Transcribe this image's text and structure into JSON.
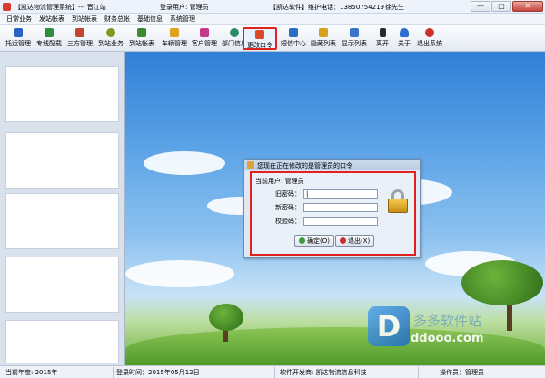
{
  "window": {
    "title": "【凯达物流管理系统】--- 晋江站",
    "login_user": "登录用户: 管理员",
    "vendor": "【凯达软件】维护电话：13850754219",
    "contact": "徐先生",
    "minimize": "—",
    "maximize": "□",
    "close": "✕"
  },
  "menu": [
    "日常业务",
    "发站帐表",
    "到站帐表",
    "财务总帐",
    "基础信息",
    "系统管理"
  ],
  "toolbar": [
    {
      "label": "托运管理",
      "icon": "consign-icon",
      "color": "#2a62c7"
    },
    {
      "label": "专线配载",
      "icon": "route-icon",
      "color": "#2f8f3e"
    },
    {
      "label": "三方管理",
      "icon": "partner-icon",
      "color": "#c6452c"
    },
    {
      "label": "到站业务",
      "icon": "arrival-icon",
      "color": "#7a9a20"
    },
    {
      "label": "到站帐表",
      "icon": "report-icon",
      "color": "#3c8a2e"
    },
    {
      "label": "车辆管理",
      "icon": "truck-icon",
      "color": "#e0a11c"
    },
    {
      "label": "客户管理",
      "icon": "customer-icon",
      "color": "#c33a8e"
    },
    {
      "label": "部门信息",
      "icon": "department-icon",
      "color": "#2b8a6a"
    },
    {
      "label": "更改口令",
      "icon": "password-icon",
      "color": "#d84a2a"
    },
    {
      "label": "短信中心",
      "icon": "sms-icon",
      "color": "#2b6fc4"
    },
    {
      "label": "隐藏列表",
      "icon": "hide-icon",
      "color": "#d8a01c"
    },
    {
      "label": "显示列表",
      "icon": "show-icon",
      "color": "#3a73c9"
    },
    {
      "label": "离开",
      "icon": "exit-run-icon",
      "color": "#2a2a2a"
    },
    {
      "label": "关于",
      "icon": "about-icon",
      "color": "#2f6fd0"
    },
    {
      "label": "退出系统",
      "icon": "shutdown-icon",
      "color": "#c9302c"
    }
  ],
  "dialog": {
    "title": "您现在正在修改的是管理员的口令",
    "current_user": "当前用户: 管理员",
    "old_password_label": "旧密码：",
    "new_password_label": "新密码：",
    "confirm_label": "校验码：",
    "old_password_value": "|",
    "confirm_button": "确定(O)",
    "exit_button": "退出(X)"
  },
  "watermark": {
    "logo": "D",
    "text1": "多多软件站",
    "text2": "ddooo.com"
  },
  "status": {
    "year": "当前年度: 2015年",
    "date": "登录时间：2015年05月12日",
    "developer": "软件开发商: 凯达物流信息科技",
    "operator": "操作员：管理员"
  }
}
